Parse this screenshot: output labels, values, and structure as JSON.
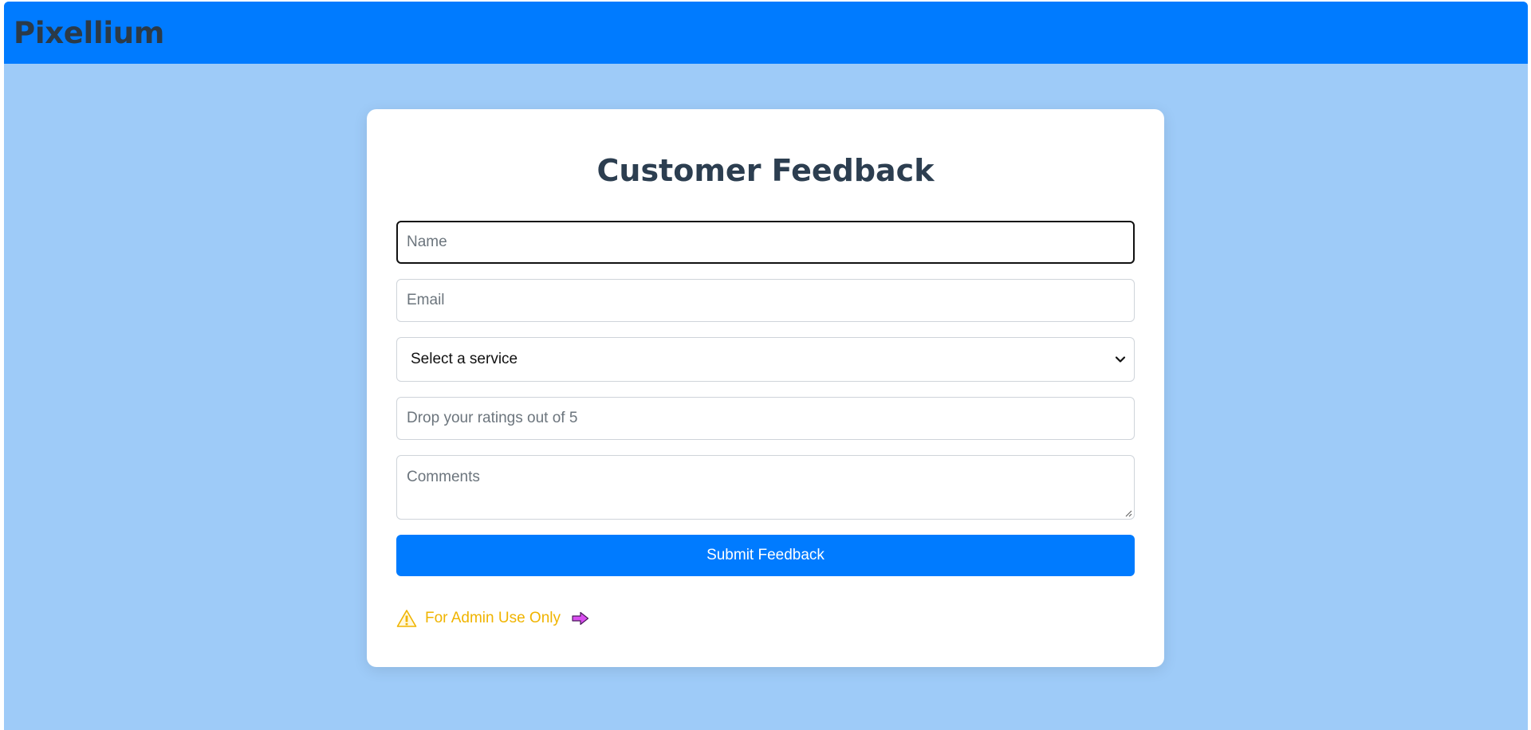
{
  "header": {
    "brand": "Pixellium"
  },
  "form": {
    "title": "Customer Feedback",
    "name_placeholder": "Name",
    "email_placeholder": "Email",
    "service_selected": "Select a service",
    "rating_placeholder": "Drop your ratings out of 5",
    "comments_placeholder": "Comments",
    "submit_label": "Submit Feedback",
    "admin_link_label": "For Admin Use Only"
  },
  "icons": {
    "select": "chevron-down-icon",
    "admin_warning": "warning-icon",
    "admin_arrow": "arrow-right-icon",
    "textarea_resize": "resize-grip-icon"
  },
  "colors": {
    "header_bg": "#007bff",
    "page_bg": "#9ecbf8",
    "card_bg": "#ffffff",
    "title": "#2c3e50",
    "button_bg": "#007bff",
    "admin_link": "#f0b400",
    "arrow_icon": "#d94ef0"
  }
}
